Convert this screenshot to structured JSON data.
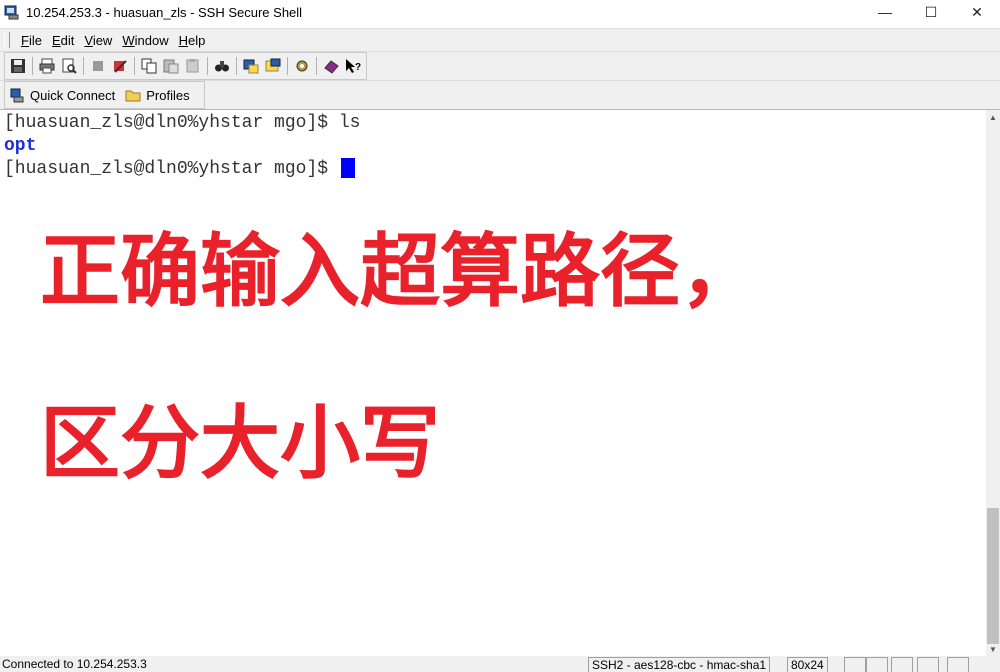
{
  "window": {
    "title": "10.254.253.3 - huasuan_zls - SSH Secure Shell",
    "minimize": "—",
    "maximize": "☐",
    "close": "✕"
  },
  "menu": {
    "items": [
      {
        "accel": "F",
        "rest": "ile"
      },
      {
        "accel": "E",
        "rest": "dit"
      },
      {
        "accel": "V",
        "rest": "iew"
      },
      {
        "accel": "W",
        "rest": "indow"
      },
      {
        "accel": "H",
        "rest": "elp"
      }
    ]
  },
  "toolbar": {
    "icons": [
      "save-icon",
      "print-icon",
      "print-preview-icon",
      "disconnect-icon",
      "connect-icon",
      "copy-icon",
      "paste-icon",
      "paste-disabled-icon",
      "find-icon",
      "file-transfer-icon",
      "new-terminal-icon",
      "settings-icon",
      "about-icon",
      "context-help-icon"
    ]
  },
  "quickbar": {
    "quick_connect": "Quick Connect",
    "profiles": "Profiles"
  },
  "terminal": {
    "lines": [
      {
        "text": "[huasuan_zls@dln0%yhstar mgo]$ ls"
      },
      {
        "text": "opt"
      },
      {
        "text": "[huasuan_zls@dln0%yhstar mgo]$ "
      }
    ],
    "cursor_color": "#0000ff"
  },
  "overlay": {
    "line1": "正确输入超算路径，",
    "line2": "区分大小写",
    "color": "#e8212b"
  },
  "status": {
    "connected": "Connected to 10.254.253.3",
    "cipher": "SSH2 - aes128-cbc - hmac-sha1",
    "size": "80x24"
  }
}
